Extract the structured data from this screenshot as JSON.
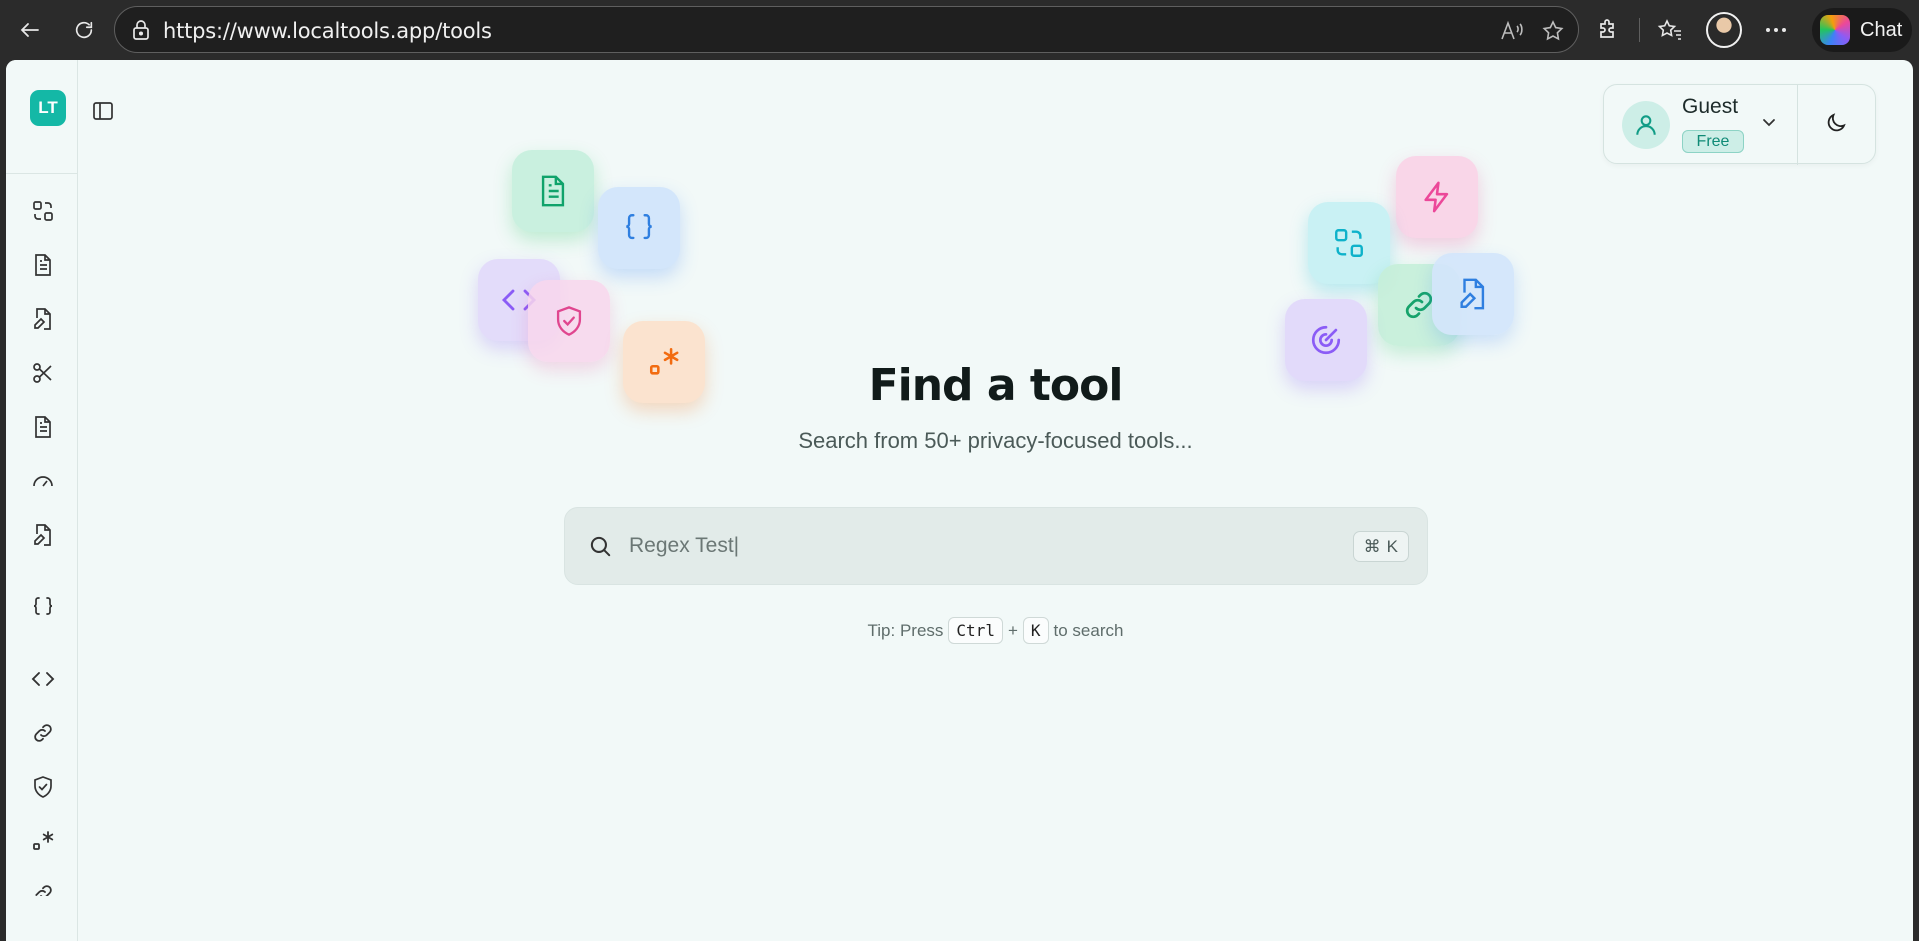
{
  "browser": {
    "url": "https://www.localtools.app/tools",
    "chat_label": "Chat"
  },
  "app": {
    "logo_text": "LT"
  },
  "sidebar": {
    "items": [
      {
        "icon": "convert-icon"
      },
      {
        "icon": "file-text-icon"
      },
      {
        "icon": "file-edit-icon"
      },
      {
        "icon": "scissors-icon"
      },
      {
        "icon": "document-icon"
      },
      {
        "icon": "gauge-icon"
      },
      {
        "icon": "file-signature-icon"
      },
      {
        "icon": "braces-icon"
      },
      {
        "icon": "code-icon"
      },
      {
        "icon": "link-icon"
      },
      {
        "icon": "shield-check-icon"
      },
      {
        "icon": "regex-icon"
      },
      {
        "icon": "more-icon"
      }
    ]
  },
  "user": {
    "name": "Guest",
    "plan": "Free"
  },
  "hero": {
    "title": "Find a tool",
    "subtitle": "Search from 50+ privacy-focused tools..."
  },
  "search": {
    "value": "Regex Test|",
    "shortcut_symbol": "⌘",
    "shortcut_key": "K"
  },
  "tip": {
    "prefix": "Tip: Press",
    "key1": "Ctrl",
    "plus": "+",
    "key2": "K",
    "suffix": "to search"
  },
  "colors": {
    "accent": "#14b8a6",
    "background": "#f2f9f8"
  }
}
